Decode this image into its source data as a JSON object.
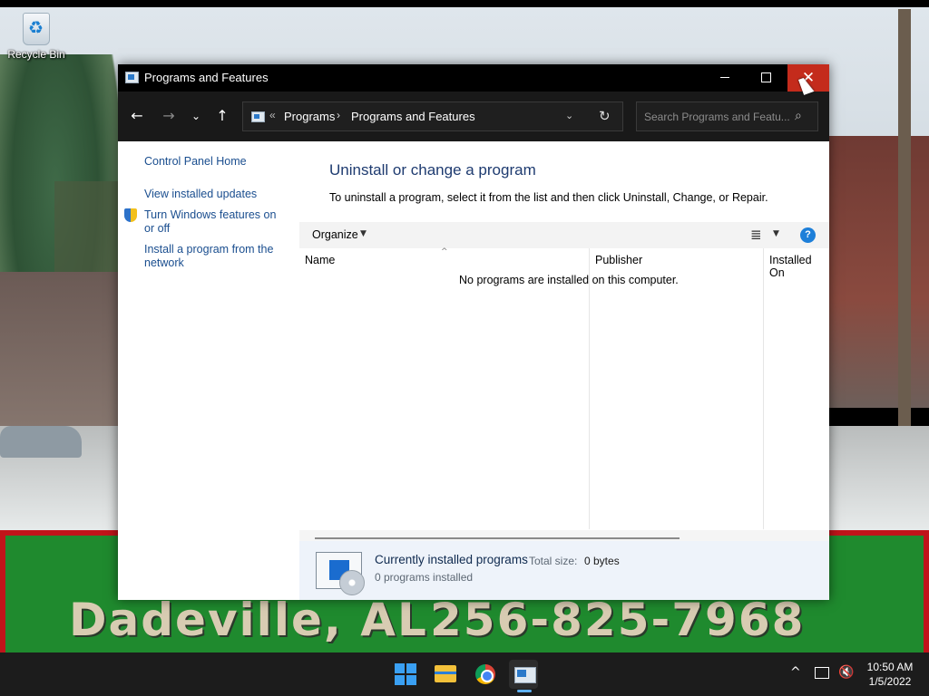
{
  "desktop": {
    "icons": [
      {
        "label": "Recycle Bin",
        "icon": "recycle-bin-icon"
      }
    ],
    "wallpaper_text": {
      "left": "Dadeville, AL",
      "right": "256-825-7968"
    }
  },
  "window": {
    "title": "Programs and Features",
    "controls": {
      "minimize": "minimize",
      "maximize": "maximize",
      "close": "✕"
    }
  },
  "navbar": {
    "back": "←",
    "forward": "→",
    "recent": "⌄",
    "up": "↑",
    "address": {
      "overflow": "«",
      "crumbs": [
        "Programs",
        "Programs and Features"
      ],
      "separator": "›",
      "dropdown": "⌄",
      "refresh": "↻"
    },
    "search": {
      "placeholder": "Search Programs and Featu...",
      "icon": "⌕"
    }
  },
  "sidebar": {
    "links": [
      "Control Panel Home",
      "View installed updates",
      "Turn Windows features on or off",
      "Install a program from the network"
    ]
  },
  "main": {
    "heading": "Uninstall or change a program",
    "description": "To uninstall a program, select it from the list and then click Uninstall, Change, or Repair.",
    "toolbar": {
      "organize": "Organize",
      "caret": "▼",
      "view_icon": "≣",
      "help": "?"
    },
    "columns": [
      "Name",
      "Publisher",
      "Installed On"
    ],
    "sort_indicator": "^",
    "empty_message": "No programs are installed on this computer."
  },
  "details": {
    "title": "Currently installed programs",
    "total_size_label": "Total size:",
    "total_size_value": "0 bytes",
    "count": "0 programs installed"
  },
  "taskbar": {
    "apps": [
      "start",
      "file-explorer",
      "chrome",
      "control-panel"
    ],
    "tray": {
      "chevron": "^",
      "volume": "🔇"
    },
    "time": "10:50 AM",
    "date": "1/5/2022"
  },
  "colors": {
    "accent": "#1d7fd9",
    "close_hover": "#c42b1c",
    "link": "#1a4e8f",
    "heading": "#1e3b70"
  }
}
